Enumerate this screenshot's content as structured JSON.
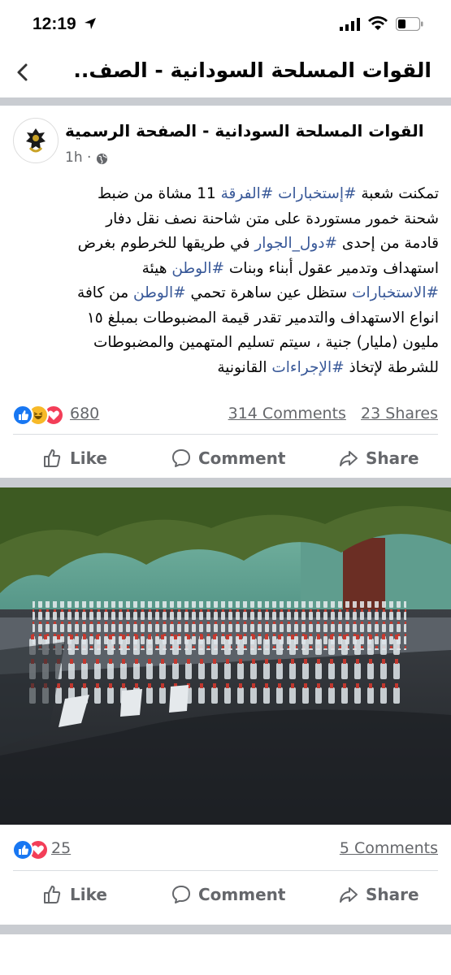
{
  "status": {
    "time": "12:19"
  },
  "nav": {
    "title": "القوات المسلحة السودانية - الصف..."
  },
  "post": {
    "page_name": "القوات المسلحة السودانية - الصفحة الرسمية",
    "time_ago": "1h ·",
    "lines": [
      [
        "تمكنت شعبة ",
        "#إستخبارات #الفرقة",
        " 11 مشاة من ضبط"
      ],
      [
        "شحنة خمور مستوردة على متن شاحنة نصف نقل دفار"
      ],
      [
        "قادمة من إحدى ",
        "#دول_الجوار",
        " في طريقها للخرطوم بغرض"
      ],
      [
        "استهداف وتدمير عقول أبناء وبنات ",
        "#الوطن",
        " هيئة"
      ],
      [
        "",
        "#الاستخبارات",
        " ستظل عين ساهرة تحمي ",
        "#الوطن",
        " من كافة"
      ],
      [
        "انواع الاستهداف والتدمير تقدر قيمة المضبوطات بمبلغ ١٥"
      ],
      [
        "مليون (مليار) جنية ، سيتم تسليم المتهمين والمضبوطات"
      ],
      [
        "للشرطة لإتخاذ ",
        "#الإجراءات",
        " القانونية"
      ]
    ],
    "reactions_count": "680",
    "comments": "314 Comments",
    "shares": "23 Shares"
  },
  "actions": {
    "like": "Like",
    "comment": "Comment",
    "share": "Share"
  },
  "photo_post": {
    "reactions_count": "25",
    "comments": "5 Comments"
  },
  "colors": {
    "like_blue": "#1877f2",
    "love_red": "#f33e58",
    "haha_yellow": "#f7b928",
    "link": "#385898",
    "gray": "#65676b"
  }
}
